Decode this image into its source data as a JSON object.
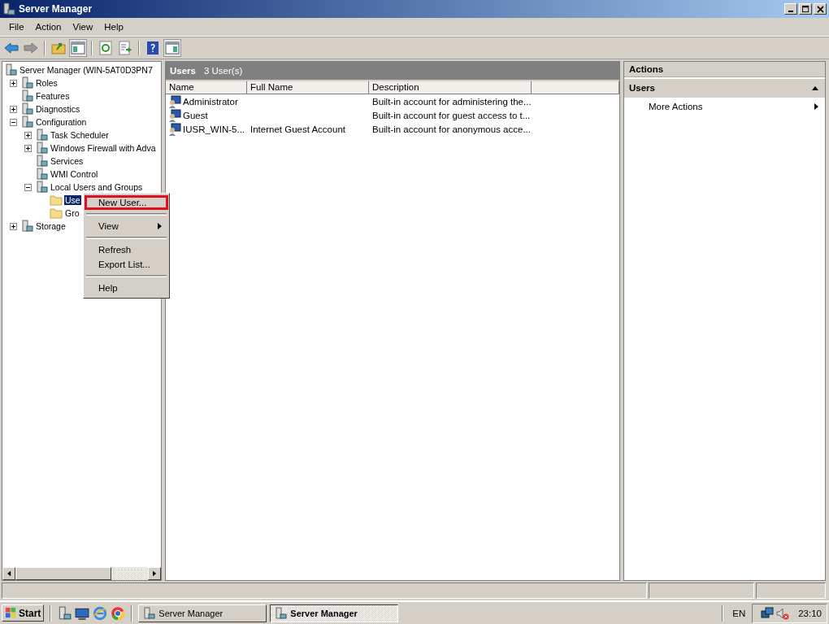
{
  "window": {
    "title": "Server Manager"
  },
  "menu_bar": [
    "File",
    "Action",
    "View",
    "Help"
  ],
  "tree": [
    {
      "label": "Server Manager (WIN-5AT0D3PN7",
      "kind": "root",
      "selected": false,
      "children": [
        {
          "label": "Roles",
          "kind": "collapsed",
          "selected": false
        },
        {
          "label": "Features",
          "kind": "leaf",
          "selected": false
        },
        {
          "label": "Diagnostics",
          "kind": "collapsed",
          "selected": false
        },
        {
          "label": "Configuration",
          "kind": "expanded",
          "selected": false,
          "children": [
            {
              "label": "Task Scheduler",
              "kind": "collapsed",
              "selected": false
            },
            {
              "label": "Windows Firewall with Adva",
              "kind": "collapsed",
              "selected": false
            },
            {
              "label": "Services",
              "kind": "leaf",
              "selected": false
            },
            {
              "label": "WMI Control",
              "kind": "leaf",
              "selected": false
            },
            {
              "label": "Local Users and Groups",
              "kind": "expanded",
              "selected": false,
              "children": [
                {
                  "label": "Use",
                  "kind": "folder",
                  "selected": true
                },
                {
                  "label": "Gro",
                  "kind": "folder",
                  "selected": false
                }
              ]
            }
          ]
        },
        {
          "label": "Storage",
          "kind": "collapsed",
          "selected": false
        }
      ]
    }
  ],
  "center": {
    "title": "Users",
    "count": "3 User(s)",
    "columns": [
      "Name",
      "Full Name",
      "Description"
    ],
    "rows": [
      {
        "name": "Administrator",
        "full_name": "",
        "description": "Built-in account for administering the..."
      },
      {
        "name": "Guest",
        "full_name": "",
        "description": "Built-in account for guest access to t..."
      },
      {
        "name": "IUSR_WIN-5...",
        "full_name": "Internet Guest Account",
        "description": "Built-in account for anonymous acce..."
      }
    ]
  },
  "actions": {
    "title": "Actions",
    "section": "Users",
    "items": [
      {
        "label": "More Actions"
      }
    ]
  },
  "context_menu": {
    "groups": [
      [
        {
          "label": "New User...",
          "highlighted": true,
          "submenu": false
        }
      ],
      [
        {
          "label": "View",
          "highlighted": false,
          "submenu": true
        }
      ],
      [
        {
          "label": "Refresh",
          "highlighted": false,
          "submenu": false
        },
        {
          "label": "Export List...",
          "highlighted": false,
          "submenu": false
        }
      ],
      [
        {
          "label": "Help",
          "highlighted": false,
          "submenu": false
        }
      ]
    ]
  },
  "taskbar": {
    "start": "Start",
    "tasks": [
      {
        "label": "Server Manager",
        "selected": false
      },
      {
        "label": "Server Manager",
        "selected": true
      }
    ],
    "language": "EN",
    "clock": "23:10"
  }
}
